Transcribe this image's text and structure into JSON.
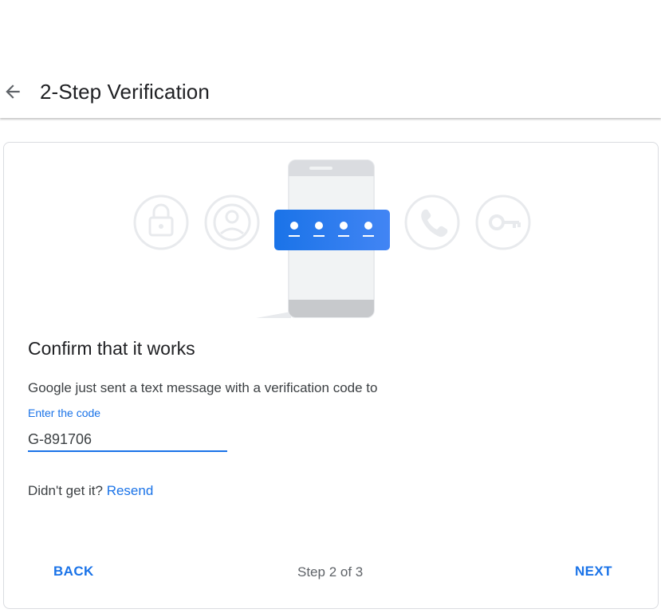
{
  "header": {
    "title": "2-Step Verification",
    "back_icon": "arrow-back-icon"
  },
  "illustration": {
    "icons": [
      "lock-icon",
      "account-circle-icon",
      "phone-icon",
      "key-icon"
    ],
    "accent_color": "#1a73e8",
    "code_dot_count": 4
  },
  "main": {
    "heading": "Confirm that it works",
    "description": "Google just sent a text message with a verification code to",
    "code_label": "Enter the code",
    "code_value": "G-891706",
    "resend_prefix": "Didn't get it?",
    "resend_link": "Resend"
  },
  "footer": {
    "back_label": "BACK",
    "step_text": "Step 2 of 3",
    "next_label": "NEXT"
  }
}
